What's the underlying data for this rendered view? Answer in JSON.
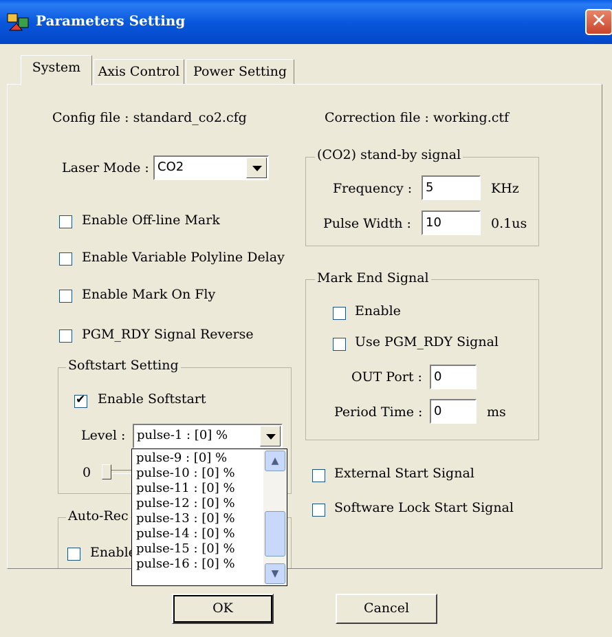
{
  "window": {
    "title": "Parameters Setting",
    "close_glyph": "✕"
  },
  "tabs": [
    {
      "label": "System"
    },
    {
      "label": "Axis Control"
    },
    {
      "label": "Power Setting"
    }
  ],
  "system": {
    "config_file": "Config file : standard_co2.cfg",
    "correction_file": "Correction file : working.ctf",
    "laser_mode_label": "Laser Mode :",
    "laser_mode_value": "CO2",
    "checks": [
      {
        "label": "Enable Off-line Mark",
        "checked": false
      },
      {
        "label": "Enable Variable Polyline Delay",
        "checked": false
      },
      {
        "label": "Enable Mark On Fly",
        "checked": false
      },
      {
        "label": "PGM_RDY Signal Reverse",
        "checked": false
      }
    ],
    "softstart": {
      "legend": "Softstart Setting",
      "enable_label": "Enable Softstart",
      "enable_checked": true,
      "level_label": "Level :",
      "level_value": "pulse-1 : [0] %",
      "slider_min_label": "0",
      "options": [
        "pulse-9 : [0] %",
        "pulse-10 : [0] %",
        "pulse-11 : [0] %",
        "pulse-12 : [0] %",
        "pulse-13 : [0] %",
        "pulse-14 : [0] %",
        "pulse-15 : [0] %",
        "pulse-16 : [0] %"
      ]
    },
    "auto_rec": {
      "legend_partial": "Auto-Rec",
      "enable_partial": "Enable"
    },
    "standby": {
      "legend": "(CO2) stand-by signal",
      "frequency_label": "Frequency :",
      "frequency_value": "5",
      "frequency_unit": "KHz",
      "pulse_width_label": "Pulse Width :",
      "pulse_width_value": "10",
      "pulse_width_unit": "0.1us"
    },
    "mark_end": {
      "legend": "Mark End Signal",
      "enable_label": "Enable",
      "use_pgm_label": "Use PGM_RDY Signal",
      "out_port_label": "OUT Port :",
      "out_port_value": "0",
      "period_label": "Period Time :",
      "period_value": "0",
      "period_unit": "ms"
    },
    "external_start_label": "External Start Signal",
    "software_lock_label": "Software Lock Start Signal"
  },
  "buttons": {
    "ok": "OK",
    "cancel": "Cancel"
  },
  "icons": {
    "app": "laser-app-icon",
    "scroll_up": "scroll-up-icon",
    "scroll_down": "scroll-down-icon"
  }
}
